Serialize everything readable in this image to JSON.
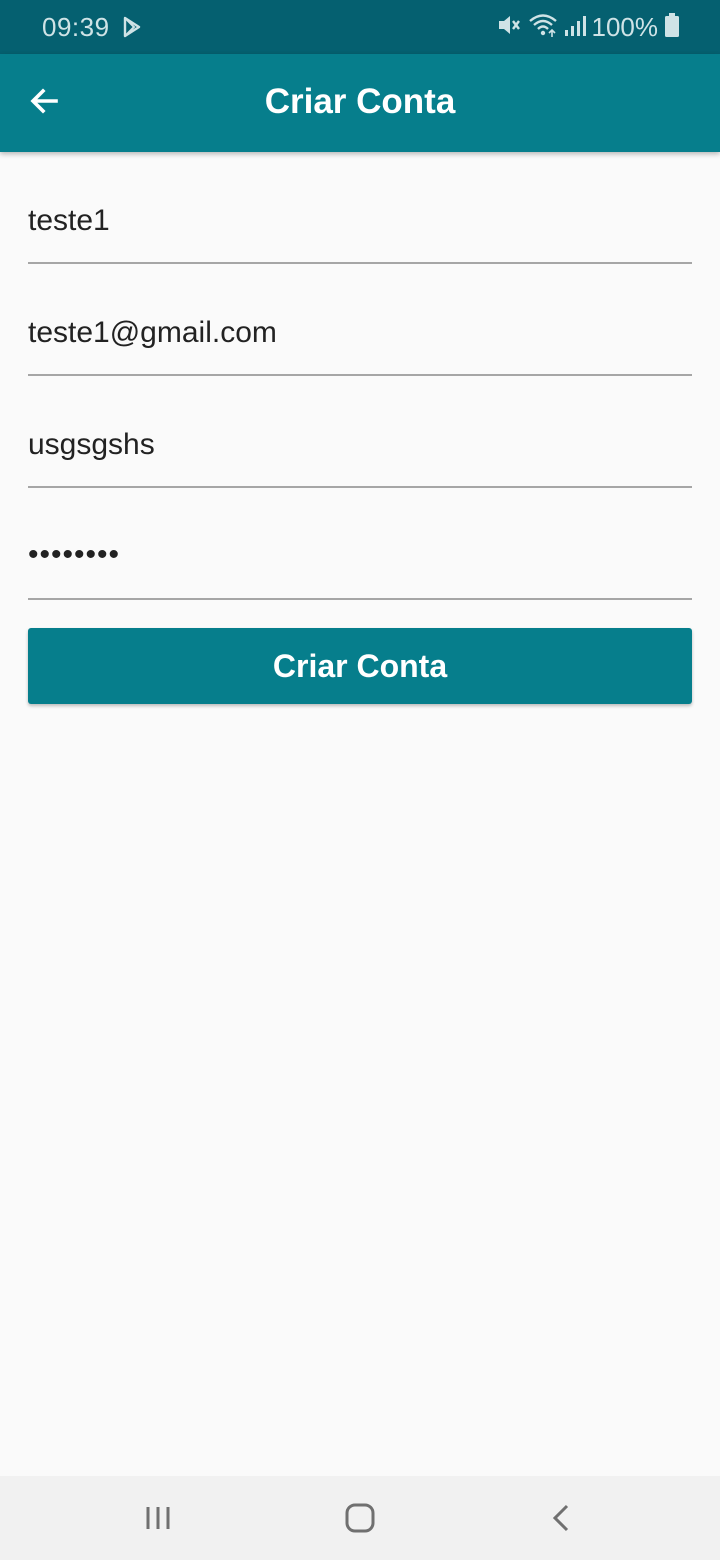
{
  "status_bar": {
    "time": "09:39",
    "battery": "100%",
    "icons": [
      "play-store-icon",
      "mute-icon",
      "wifi-icon",
      "signal-icon",
      "battery-icon"
    ],
    "background": "#056070"
  },
  "app_bar": {
    "title": "Criar Conta",
    "back_icon": "arrow-back-icon",
    "background": "#067e8c"
  },
  "form": {
    "fields": [
      {
        "name": "name",
        "value": "teste1"
      },
      {
        "name": "email",
        "value": "teste1@gmail.com"
      },
      {
        "name": "username",
        "value": "usgsgshs"
      },
      {
        "name": "password",
        "value": "••••••••"
      }
    ],
    "submit_label": "Criar Conta",
    "accent": "#067e8c"
  },
  "nav_bar": {
    "buttons": [
      "recent-apps-icon",
      "home-icon",
      "back-icon"
    ]
  }
}
